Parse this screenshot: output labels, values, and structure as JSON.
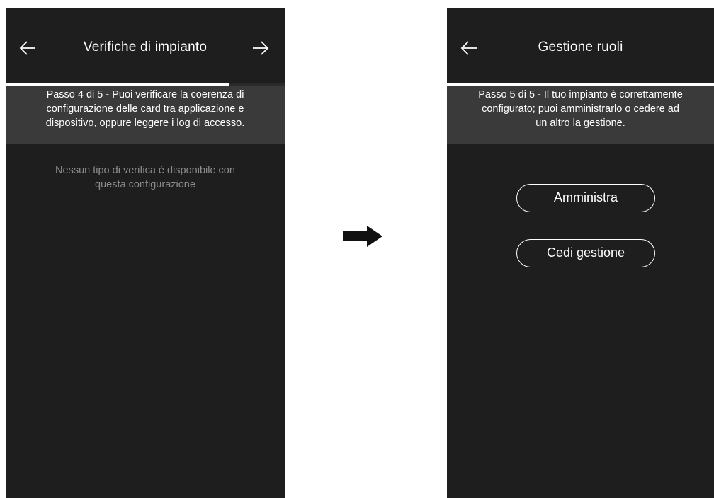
{
  "left_screen": {
    "title": "Verifiche di impianto",
    "back_icon": "arrow-left-icon",
    "next_icon": "arrow-right-icon",
    "progress_fraction": 0.8,
    "info_lines": [
      "Passo 4 di 5 - Puoi verificare la coerenza di",
      "configurazione delle card tra applicazione e",
      "dispositivo, oppure leggere i log di accesso."
    ],
    "empty_lines": [
      "Nessun tipo di verifica è disponibile con",
      "questa configurazione"
    ]
  },
  "connector_icon": "flow-arrow-right-icon",
  "right_screen": {
    "title": "Gestione ruoli",
    "back_icon": "arrow-left-icon",
    "progress_fraction": 1.0,
    "info_lines": [
      "Passo 5 di 5 - Il tuo impianto è correttamente",
      "configurato; puoi amministrarlo o cedere ad",
      "un altro la gestione."
    ],
    "buttons": {
      "administer": "Amministra",
      "transfer": "Cedi gestione"
    }
  },
  "colors": {
    "screen_bg": "#1e1e1e",
    "info_bg": "#3a3a3a",
    "text": "#ffffff",
    "muted_text": "#8c8c8c"
  }
}
